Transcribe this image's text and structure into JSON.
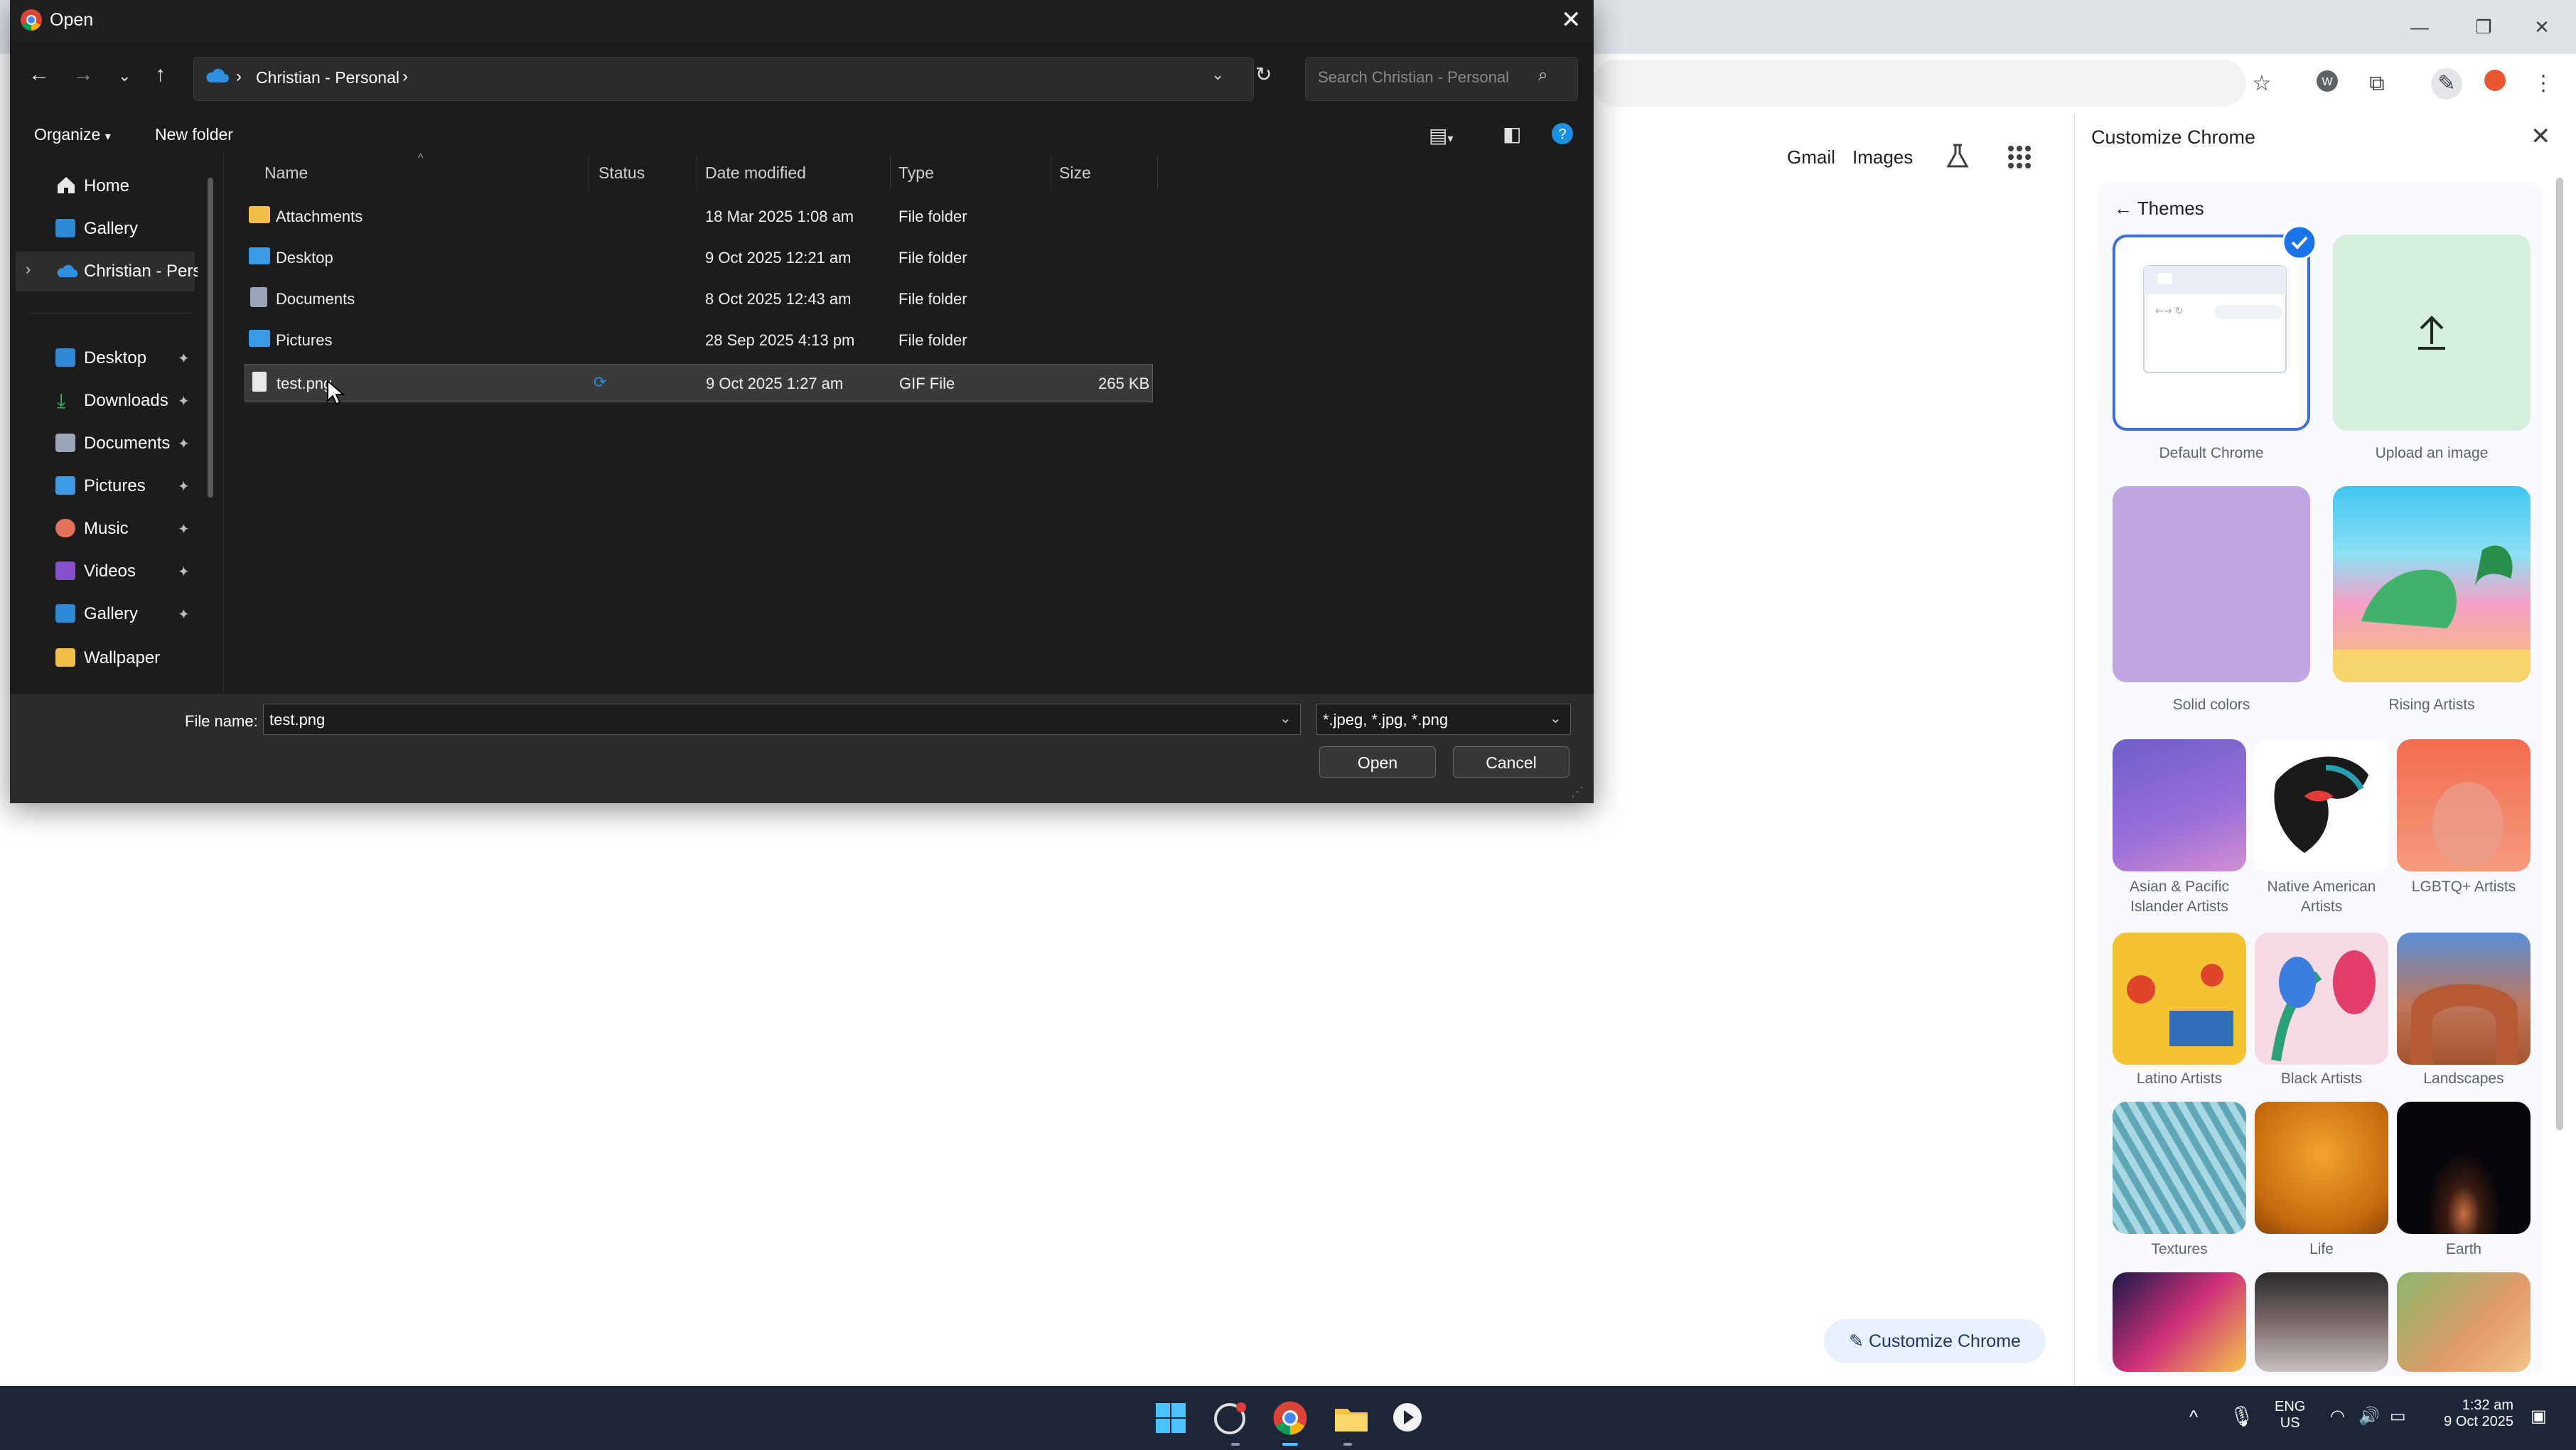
{
  "colors": {
    "accent": "#1a73e8",
    "dialog_bg": "#1c1c1c",
    "taskbar": "#1c2638",
    "selection": "#3a3a3a"
  },
  "chrome": {
    "window_controls": [
      "—",
      "❐",
      "✕"
    ],
    "page_links": {
      "gmail": "Gmail",
      "images": "Images"
    },
    "customize_button": "Customize Chrome"
  },
  "panel": {
    "title": "Customize Chrome",
    "themes_heading": "Themes",
    "themes": [
      {
        "label": "Default Chrome",
        "selected": true
      },
      {
        "label": "Upload an image"
      },
      {
        "label": "Solid colors"
      },
      {
        "label": "Rising Artists"
      },
      {
        "label": "Asian & Pacific Islander Artists"
      },
      {
        "label": "Native American Artists"
      },
      {
        "label": "LGBTQ+ Artists"
      },
      {
        "label": "Latino Artists"
      },
      {
        "label": "Black Artists"
      },
      {
        "label": "Landscapes"
      },
      {
        "label": "Textures"
      },
      {
        "label": "Life"
      },
      {
        "label": "Earth"
      }
    ]
  },
  "dialog": {
    "title": "Open",
    "breadcrumb": "Christian - Personal",
    "search_placeholder": "Search Christian - Personal",
    "commands": {
      "organize": "Organize",
      "new_folder": "New folder"
    },
    "nav_top": [
      {
        "label": "Home",
        "icon": "home-icon"
      },
      {
        "label": "Gallery",
        "icon": "gallery-icon"
      },
      {
        "label": "Christian - Perso",
        "icon": "onedrive-icon"
      }
    ],
    "nav_pinned": [
      {
        "label": "Desktop",
        "icon": "desktop-icon"
      },
      {
        "label": "Downloads",
        "icon": "downloads-icon"
      },
      {
        "label": "Documents",
        "icon": "documents-icon"
      },
      {
        "label": "Pictures",
        "icon": "pictures-icon"
      },
      {
        "label": "Music",
        "icon": "music-icon"
      },
      {
        "label": "Videos",
        "icon": "videos-icon"
      },
      {
        "label": "Gallery",
        "icon": "gallery-icon"
      },
      {
        "label": "Wallpaper",
        "icon": "folder-icon"
      }
    ],
    "columns": {
      "name": "Name",
      "status": "Status",
      "date": "Date modified",
      "type": "Type",
      "size": "Size"
    },
    "files": [
      {
        "name": "Attachments",
        "date": "18 Mar 2025 1:08 am",
        "type": "File folder",
        "size": ""
      },
      {
        "name": "Desktop",
        "date": "9 Oct 2025 12:21 am",
        "type": "File folder",
        "size": ""
      },
      {
        "name": "Documents",
        "date": "8 Oct 2025 12:43 am",
        "type": "File folder",
        "size": ""
      },
      {
        "name": "Pictures",
        "date": "28 Sep 2025 4:13 pm",
        "type": "File folder",
        "size": ""
      },
      {
        "name": "test.png",
        "date": "9 Oct 2025 1:27 am",
        "type": "GIF File",
        "size": "265 KB"
      }
    ],
    "file_name_label": "File name:",
    "file_name_value": "test.png",
    "file_type_value": "*.jpeg, *.jpg, *.png",
    "open_button": "Open",
    "cancel_button": "Cancel"
  },
  "taskbar": {
    "lang": "ENG",
    "region": "US",
    "time": "1:32 am",
    "date": "9 Oct 2025"
  }
}
